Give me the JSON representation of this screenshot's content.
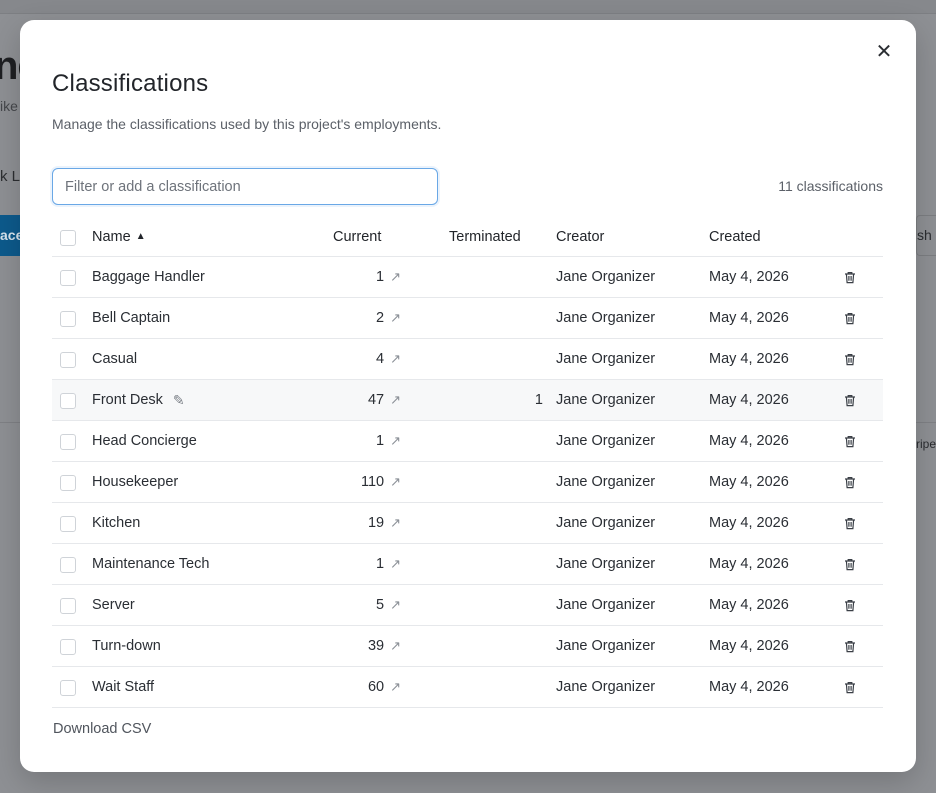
{
  "background": {
    "title_fragment": "ne",
    "subtitle_fragment": "ike",
    "tab_fragment": "k Li",
    "button_left_fragment": "ace",
    "button_right_fragment": "sh",
    "right_text_fragment": "ripe"
  },
  "modal": {
    "title": "Classifications",
    "description": "Manage the classifications used by this project's employments.",
    "close_icon": "close-icon",
    "filter_placeholder": "Filter or add a classification",
    "filter_value": "",
    "count_label": "11 classifications",
    "download_label": "Download CSV"
  },
  "table": {
    "headers": {
      "name": "Name",
      "name_sort": "▲",
      "current": "Current",
      "terminated": "Terminated",
      "creator": "Creator",
      "created": "Created"
    },
    "rows": [
      {
        "name": "Baggage Handler",
        "current": "1",
        "terminated": "",
        "creator": "Jane Organizer",
        "created": "May 4, 2026"
      },
      {
        "name": "Bell Captain",
        "current": "2",
        "terminated": "",
        "creator": "Jane Organizer",
        "created": "May 4, 2026"
      },
      {
        "name": "Casual",
        "current": "4",
        "terminated": "",
        "creator": "Jane Organizer",
        "created": "May 4, 2026"
      },
      {
        "name": "Front Desk",
        "current": "47",
        "terminated": "1",
        "creator": "Jane Organizer",
        "created": "May 4, 2026"
      },
      {
        "name": "Head Concierge",
        "current": "1",
        "terminated": "",
        "creator": "Jane Organizer",
        "created": "May 4, 2026"
      },
      {
        "name": "Housekeeper",
        "current": "110",
        "terminated": "",
        "creator": "Jane Organizer",
        "created": "May 4, 2026"
      },
      {
        "name": "Kitchen",
        "current": "19",
        "terminated": "",
        "creator": "Jane Organizer",
        "created": "May 4, 2026"
      },
      {
        "name": "Maintenance Tech",
        "current": "1",
        "terminated": "",
        "creator": "Jane Organizer",
        "created": "May 4, 2026"
      },
      {
        "name": "Server",
        "current": "5",
        "terminated": "",
        "creator": "Jane Organizer",
        "created": "May 4, 2026"
      },
      {
        "name": "Turn-down",
        "current": "39",
        "terminated": "",
        "creator": "Jane Organizer",
        "created": "May 4, 2026"
      },
      {
        "name": "Wait Staff",
        "current": "60",
        "terminated": "",
        "creator": "Jane Organizer",
        "created": "May 4, 2026"
      }
    ]
  },
  "icons": {
    "external": "↗",
    "edit": "pencil-icon",
    "delete": "trash-icon"
  }
}
